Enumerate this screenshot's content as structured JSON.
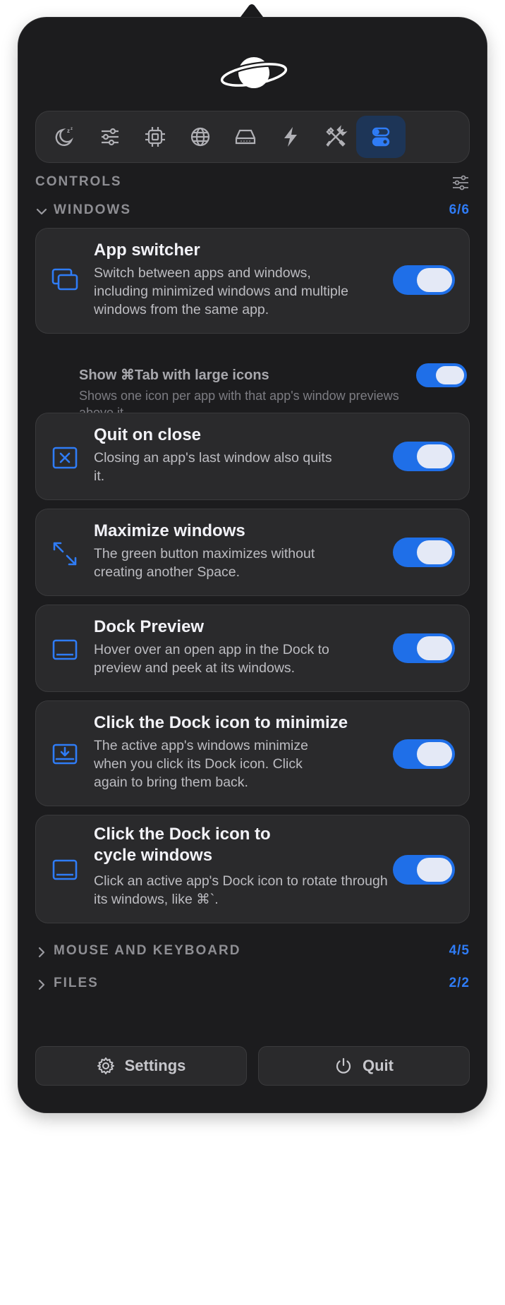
{
  "tabs": [
    {
      "icon": "sleep-moon-icon"
    },
    {
      "icon": "sliders-icon"
    },
    {
      "icon": "cpu-chip-icon"
    },
    {
      "icon": "globe-icon"
    },
    {
      "icon": "disk-drive-icon"
    },
    {
      "icon": "lightning-bolt-icon"
    },
    {
      "icon": "tools-icon"
    },
    {
      "icon": "toggles-icon",
      "active": true
    }
  ],
  "section_title": "CONTROLS",
  "windows_group": {
    "label": "WINDOWS",
    "count": "6/6"
  },
  "controls": [
    {
      "title": "App switcher",
      "desc": "Switch between apps and windows, including minimized windows and multiple windows from the same app.",
      "on": true
    },
    {
      "title": "Quit on close",
      "desc": "Closing an app's last window also quits it.",
      "on": true
    },
    {
      "title": "Maximize windows",
      "desc": "The green button maximizes without creating another Space.",
      "on": true
    },
    {
      "title": "Dock Preview",
      "desc": "Hover over an open app in the Dock to preview and peek at its windows.",
      "on": true
    },
    {
      "title": "Click the Dock icon to minimize",
      "desc": "The active app's windows minimize when you click its Dock icon. Click again to bring them back.",
      "on": true
    },
    {
      "title": "Click the Dock icon to cycle windows",
      "desc": "Click an active app's Dock icon to rotate through its windows, like ⌘`.",
      "on": true
    }
  ],
  "sub_option": {
    "title": "Show ⌘Tab with large icons",
    "desc": "Shows one icon per app with that app's window previews above it.",
    "on": true
  },
  "mouse_group": {
    "label": "MOUSE AND KEYBOARD",
    "count": "4/5"
  },
  "files_group": {
    "label": "FILES",
    "count": "2/2"
  },
  "buttons": {
    "settings": "Settings",
    "quit": "Quit"
  },
  "colors": {
    "accent": "#2f7cf6",
    "panel": "#1c1c1e",
    "card": "#2a2a2c"
  }
}
